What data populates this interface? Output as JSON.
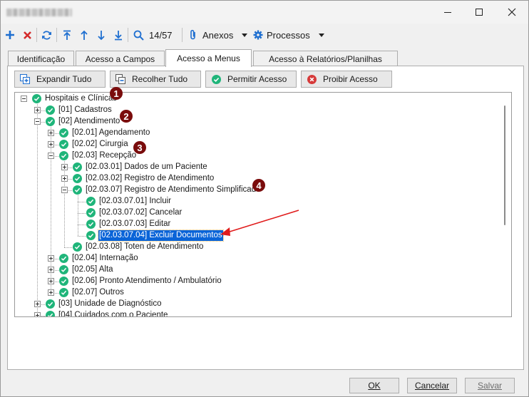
{
  "toolbar": {
    "counter": "14/57",
    "anexos": "Anexos",
    "processos": "Processos"
  },
  "tabs": [
    {
      "label": "Identificação"
    },
    {
      "label": "Acesso a Campos"
    },
    {
      "label": "Acesso a Menus"
    },
    {
      "label": "Acesso à Relatórios/Planilhas"
    }
  ],
  "actions": {
    "expand": "Expandir Tudo",
    "collapse": "Recolher Tudo",
    "allow": "Permitir Acesso",
    "deny": "Proibir Acesso"
  },
  "tree": [
    {
      "label": "Hospitais e Clínicas",
      "level": 0,
      "expander": "minus"
    },
    {
      "label": "[01] Cadastros",
      "level": 1,
      "expander": "plus"
    },
    {
      "label": "[02] Atendimento",
      "level": 1,
      "expander": "minus"
    },
    {
      "label": "[02.01] Agendamento",
      "level": 2,
      "expander": "plus"
    },
    {
      "label": "[02.02] Cirurgia",
      "level": 2,
      "expander": "plus"
    },
    {
      "label": "[02.03] Recepção",
      "level": 2,
      "expander": "minus"
    },
    {
      "label": "[02.03.01] Dados de um Paciente",
      "level": 3,
      "expander": "plus"
    },
    {
      "label": "[02.03.02] Registro de Atendimento",
      "level": 3,
      "expander": "plus"
    },
    {
      "label": "[02.03.07] Registro de Atendimento Simplificado",
      "level": 3,
      "expander": "minus"
    },
    {
      "label": "[02.03.07.01] Incluir",
      "level": 4,
      "expander": "none"
    },
    {
      "label": "[02.03.07.02] Cancelar",
      "level": 4,
      "expander": "none"
    },
    {
      "label": "[02.03.07.03] Editar",
      "level": 4,
      "expander": "none"
    },
    {
      "label": "[02.03.07.04] Excluir Documentos",
      "level": 4,
      "expander": "none",
      "selected": true
    },
    {
      "label": "[02.03.08] Toten de Atendimento",
      "level": 3,
      "expander": "none"
    },
    {
      "label": "[02.04] Internação",
      "level": 2,
      "expander": "plus"
    },
    {
      "label": "[02.05] Alta",
      "level": 2,
      "expander": "plus"
    },
    {
      "label": "[02.06] Pronto Atendimento / Ambulatório",
      "level": 2,
      "expander": "plus"
    },
    {
      "label": "[02.07] Outros",
      "level": 2,
      "expander": "plus"
    },
    {
      "label": "[03] Unidade de Diagnóstico",
      "level": 1,
      "expander": "plus"
    },
    {
      "label": "[04] Cuidados com o Paciente",
      "level": 1,
      "expander": "plus"
    }
  ],
  "badges": [
    "1",
    "2",
    "3",
    "4"
  ],
  "footer": {
    "ok": "OK",
    "cancel": "Cancelar",
    "save": "Salvar"
  },
  "colors": {
    "check": "#1fb57a",
    "selection": "#0a64d8",
    "badge": "#7a0c0c",
    "arrow": "#e01b1b"
  }
}
